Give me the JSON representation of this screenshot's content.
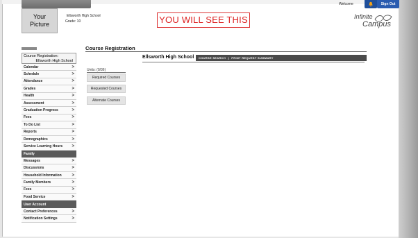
{
  "header": {
    "photo_line1": "Your",
    "photo_line2": "Picture",
    "school": "Ellsworth High School",
    "grade": "Grade: 10",
    "announcement": "YOU WILL SEE THIS",
    "welcome": "Welcome",
    "signout": "Sign Out",
    "logo_line1": "Infinite",
    "logo_line2": "Campus"
  },
  "sidebar": {
    "title_line1": "Course Registration:",
    "title_line2": "Ellsworth High School",
    "items": [
      {
        "label": "Calendar"
      },
      {
        "label": "Schedule"
      },
      {
        "label": "Attendance"
      },
      {
        "label": "Grades"
      },
      {
        "label": "Health"
      },
      {
        "label": "Assessment"
      },
      {
        "label": "Graduation Progress"
      },
      {
        "label": "Fees"
      },
      {
        "label": "To Do List"
      },
      {
        "label": "Reports"
      },
      {
        "label": "Demographics"
      },
      {
        "label": "Service Learning Hours"
      }
    ],
    "family_label": "Family",
    "family_items": [
      {
        "label": "Messages"
      },
      {
        "label": "Discussions"
      },
      {
        "label": "Household Information"
      },
      {
        "label": "Family Members"
      },
      {
        "label": "Fees"
      },
      {
        "label": "Food Service"
      }
    ],
    "account_label": "User Account",
    "account_items": [
      {
        "label": "Contact Preferences"
      },
      {
        "label": "Notification Settings"
      }
    ],
    "chevron": ">"
  },
  "main": {
    "title": "Course Registration",
    "school": "Ellsworth High School",
    "nav_search": "COURSE SEARCH",
    "nav_sep": "|",
    "nav_print": "PRINT REQUEST SUMMARY",
    "units": "Units: (0/36)",
    "buttons": [
      {
        "label": "Required Courses"
      },
      {
        "label": "Requested Courses"
      },
      {
        "label": "Alternate Courses"
      }
    ]
  },
  "icons": {
    "bell": "bell-icon",
    "logo": "infinite-campus-logo-icon"
  },
  "colors": {
    "accent_blue": "#2a5cb0",
    "announcement_red": "#dd2222",
    "section_dark": "#5a5a5a"
  }
}
